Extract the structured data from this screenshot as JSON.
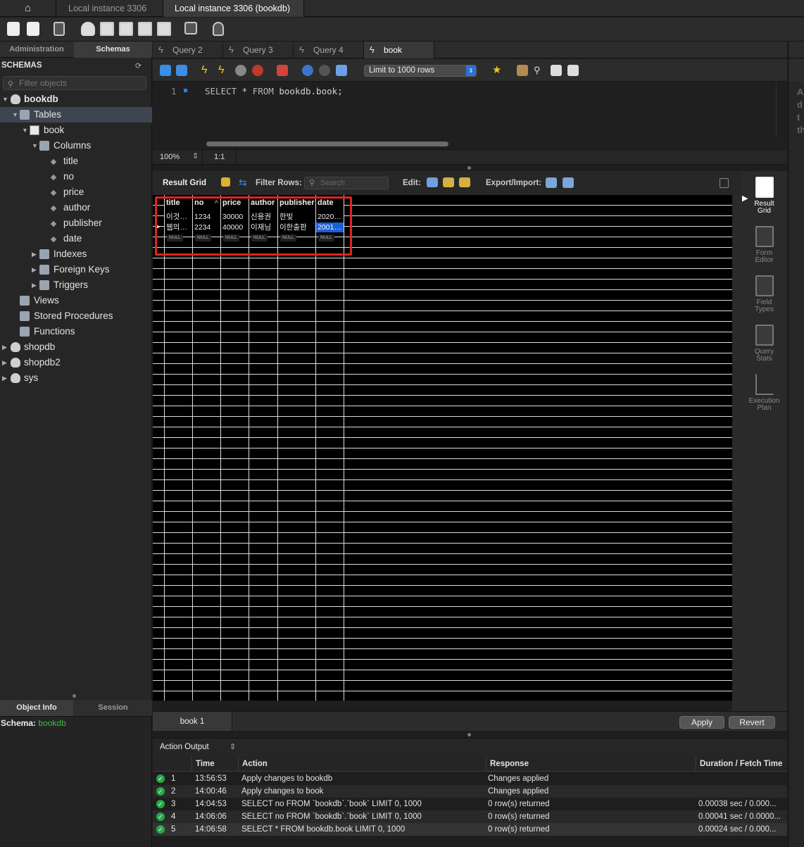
{
  "connection_tabs": {
    "home_icon": "home-icon",
    "tab1": "Local instance 3306",
    "tab2": "Local instance 3306 (bookdb)"
  },
  "sidebar": {
    "tab_admin": "Administration",
    "tab_schemas": "Schemas",
    "header": "SCHEMAS",
    "filter_placeholder": "Filter objects",
    "tree": {
      "bookdb": "bookdb",
      "tables": "Tables",
      "book": "book",
      "columns": "Columns",
      "col_title": "title",
      "col_no": "no",
      "col_price": "price",
      "col_author": "author",
      "col_publisher": "publisher",
      "col_date": "date",
      "indexes": "Indexes",
      "foreign_keys": "Foreign Keys",
      "triggers": "Triggers",
      "views": "Views",
      "stored_procedures": "Stored Procedures",
      "functions": "Functions",
      "shopdb": "shopdb",
      "shopdb2": "shopdb2",
      "sys": "sys"
    }
  },
  "object_info": {
    "tab_info": "Object Info",
    "tab_session": "Session",
    "schema_label": "Schema:",
    "schema_value": "bookdb"
  },
  "editor_tabs": [
    "Query 2",
    "Query 3",
    "Query 4",
    "book"
  ],
  "sql_toolbar": {
    "limit": "Limit to 1000 rows"
  },
  "editor": {
    "line": "1",
    "code_kw1": "SELECT",
    "code_star": " * ",
    "code_kw2": "FROM",
    "code_rest": " bookdb.book;"
  },
  "editor_status": {
    "zoom": "100%",
    "position": "1:1"
  },
  "result_toolbar": {
    "result_grid": "Result Grid",
    "filter_rows": "Filter Rows:",
    "search_placeholder": "Search",
    "edit": "Edit:",
    "export_import": "Export/Import:"
  },
  "grid": {
    "columns": [
      "title",
      "no",
      "price",
      "author",
      "publisher",
      "date"
    ],
    "rows": [
      [
        "이것…",
        "1234",
        "30000",
        "신용권",
        "한빛",
        "2020…"
      ],
      [
        "웹의…",
        "2234",
        "40000",
        "이재님",
        "이한출판",
        "2001…"
      ]
    ],
    "null_label": "NULL"
  },
  "right_panel": {
    "result_grid": [
      "Result",
      "Grid"
    ],
    "form_editor": [
      "Form",
      "Editor"
    ],
    "field_types": [
      "Field",
      "Types"
    ],
    "query_stats": [
      "Query",
      "Stats"
    ],
    "execution_plan": [
      "Execution",
      "Plan"
    ]
  },
  "result_bar": {
    "tab": "book 1",
    "apply": "Apply",
    "revert": "Revert"
  },
  "action_output": {
    "title": "Action Output",
    "headers": {
      "time": "Time",
      "action": "Action",
      "response": "Response",
      "duration": "Duration / Fetch Time"
    },
    "rows": [
      {
        "n": "1",
        "time": "13:56:53",
        "action": "Apply changes to bookdb",
        "response": "Changes applied",
        "duration": ""
      },
      {
        "n": "2",
        "time": "14:00:46",
        "action": "Apply changes to book",
        "response": "Changes applied",
        "duration": ""
      },
      {
        "n": "3",
        "time": "14:04:53",
        "action": "SELECT no FROM `bookdb`.`book` LIMIT 0, 1000",
        "response": "0 row(s) returned",
        "duration": "0.00038 sec / 0.000..."
      },
      {
        "n": "4",
        "time": "14:06:06",
        "action": "SELECT no FROM `bookdb`.`book` LIMIT 0, 1000",
        "response": "0 row(s) returned",
        "duration": "0.00041 sec / 0.0000..."
      },
      {
        "n": "5",
        "time": "14:06:58",
        "action": "SELECT * FROM bookdb.book LIMIT 0, 1000",
        "response": "0 row(s) returned",
        "duration": "0.00024 sec / 0.000..."
      }
    ]
  },
  "far_panel": {
    "letters": "A\nd\nt\nth"
  },
  "colors": {
    "accent": "#2e7bff",
    "highlight": "#e0251d",
    "success": "#28a745",
    "schema_green": "#3fbf3f"
  }
}
